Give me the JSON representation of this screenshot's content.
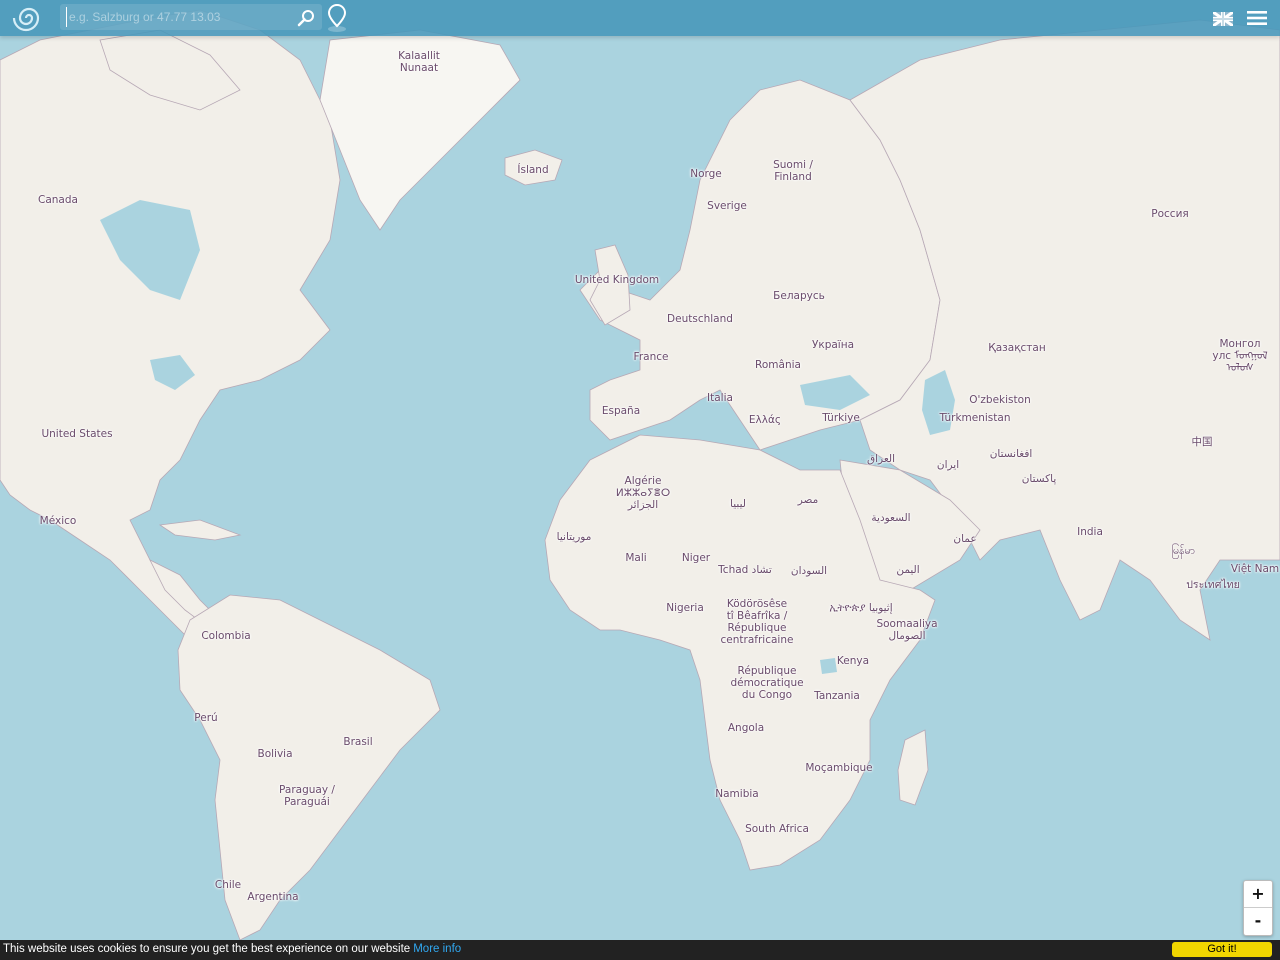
{
  "search": {
    "placeholder": "e.g. Salzburg or 47.77 13.03",
    "value": ""
  },
  "icons": {
    "logo": "spiral-logo-icon",
    "search": "magnifier-icon",
    "locate": "location-pin-icon",
    "language": "uk-flag-icon",
    "menu": "hamburger-menu-icon"
  },
  "colors": {
    "water": "#aad3df",
    "land": "#f2efe9",
    "border": "#b7a8b5",
    "topbar": "#4696b9",
    "label": "#6a4b6b",
    "cookie_button": "#f1d600",
    "cookie_link": "#31a8f0"
  },
  "map": {
    "labels": [
      {
        "name": "Kalaallit\nNunaat"
      },
      {
        "name": "Ísland"
      },
      {
        "name": "Canada"
      },
      {
        "name": "Norge"
      },
      {
        "name": "Suomi /\nFinland"
      },
      {
        "name": "Sverige"
      },
      {
        "name": "Россия"
      },
      {
        "name": "United Kingdom"
      },
      {
        "name": "Беларусь"
      },
      {
        "name": "Deutschland"
      },
      {
        "name": "Україна"
      },
      {
        "name": "France"
      },
      {
        "name": "România"
      },
      {
        "name": "Қазақстан"
      },
      {
        "name": "Монгол\nулс ᠮᠣᠩᠭᠣᠯ\nᠤᠯᠤᠰ"
      },
      {
        "name": "Italia"
      },
      {
        "name": "O'zbekiston"
      },
      {
        "name": "España"
      },
      {
        "name": "Türkiye"
      },
      {
        "name": "Ελλάς"
      },
      {
        "name": "Türkmenistan"
      },
      {
        "name": "United States"
      },
      {
        "name": "中国"
      },
      {
        "name": "العراق"
      },
      {
        "name": "افغانستان"
      },
      {
        "name": "ایران"
      },
      {
        "name": "Algérie\nⵍⵣⵣⴰⵢⴻⵔ\nالجزائر"
      },
      {
        "name": "پاکستان"
      },
      {
        "name": "ليبيا"
      },
      {
        "name": "مصر"
      },
      {
        "name": "السعودية"
      },
      {
        "name": "México"
      },
      {
        "name": "India"
      },
      {
        "name": "عمان"
      },
      {
        "name": "موريتانيا"
      },
      {
        "name": "မြန်မာ"
      },
      {
        "name": "Việt Nam"
      },
      {
        "name": "Mali"
      },
      {
        "name": "Niger"
      },
      {
        "name": "Tchad تشاد"
      },
      {
        "name": "السودان"
      },
      {
        "name": "اليمن"
      },
      {
        "name": "ประเทศไทย"
      },
      {
        "name": "Nigeria"
      },
      {
        "name": "Ködörösêse\ntî Bêafrîka /\nRépublique\ncentrafricaine"
      },
      {
        "name": "ኢትዮጵያ إثيوبيا"
      },
      {
        "name": "Soomaaliya\nالصومال"
      },
      {
        "name": "Colombia"
      },
      {
        "name": "Kenya"
      },
      {
        "name": "République\ndémocratique\ndu Congo"
      },
      {
        "name": "Tanzania"
      },
      {
        "name": "Perú"
      },
      {
        "name": "Angola"
      },
      {
        "name": "Brasil"
      },
      {
        "name": "Bolivia"
      },
      {
        "name": "Moçambique"
      },
      {
        "name": "Paraguay /\nParaguái"
      },
      {
        "name": "Namibia"
      },
      {
        "name": "South Africa"
      },
      {
        "name": "Chile"
      },
      {
        "name": "Argentina"
      }
    ]
  },
  "zoom": {
    "in_label": "+",
    "out_label": "-"
  },
  "cookie": {
    "message": "This website uses cookies to ensure you get the best experience on our website",
    "link_text": "More info",
    "button_label": "Got it!"
  }
}
